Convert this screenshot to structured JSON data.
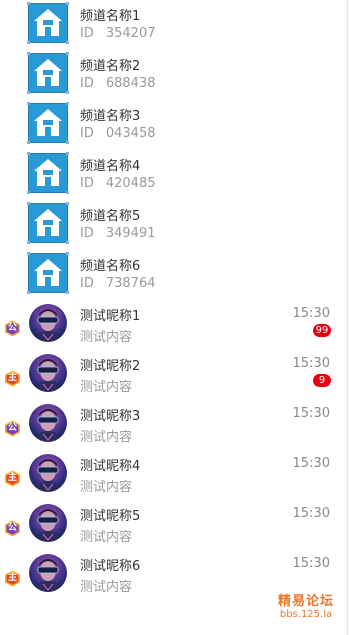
{
  "channels": [
    {
      "name": "频道名称1",
      "id_label": "ID",
      "id": "354207",
      "icon": "home-icon"
    },
    {
      "name": "频道名称2",
      "id_label": "ID",
      "id": "688438",
      "icon": "home-icon"
    },
    {
      "name": "频道名称3",
      "id_label": "ID",
      "id": "043458",
      "icon": "home-icon"
    },
    {
      "name": "频道名称4",
      "id_label": "ID",
      "id": "420485",
      "icon": "home-icon"
    },
    {
      "name": "频道名称5",
      "id_label": "ID",
      "id": "349491",
      "icon": "home-icon"
    },
    {
      "name": "频道名称6",
      "id_label": "ID",
      "id": "738764",
      "icon": "home-icon"
    }
  ],
  "contacts": [
    {
      "nickname": "测试昵称1",
      "content": "测试内容",
      "time": "15:30",
      "badge": "公",
      "badge_color": "#7b3fc4",
      "unread": "99"
    },
    {
      "nickname": "测试昵称2",
      "content": "测试内容",
      "time": "15:30",
      "badge": "主",
      "badge_color": "#e8452a",
      "unread": "9"
    },
    {
      "nickname": "测试昵称3",
      "content": "测试内容",
      "time": "15:30",
      "badge": "公",
      "badge_color": "#7b3fc4",
      "unread": ""
    },
    {
      "nickname": "测试昵称4",
      "content": "测试内容",
      "time": "15:30",
      "badge": "主",
      "badge_color": "#e8452a",
      "unread": ""
    },
    {
      "nickname": "测试昵称5",
      "content": "测试内容",
      "time": "15:30",
      "badge": "公",
      "badge_color": "#7b3fc4",
      "unread": ""
    },
    {
      "nickname": "测试昵称6",
      "content": "测试内容",
      "time": "15:30",
      "badge": "主",
      "badge_color": "#e8452a",
      "unread": ""
    }
  ],
  "colors": {
    "unread_bg": "#e60012",
    "channel_tile": "#2a9ad6",
    "watermark": "#e8772e"
  },
  "watermark": {
    "title": "精易论坛",
    "url": "bbs.125.la"
  }
}
